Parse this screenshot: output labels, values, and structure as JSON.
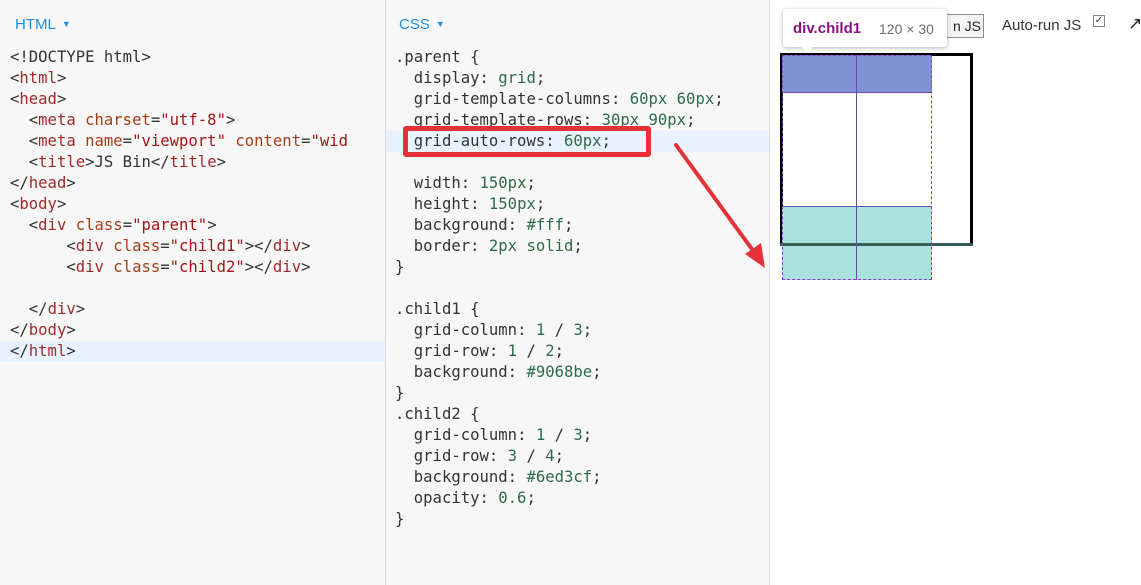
{
  "html_panel": {
    "label": "HTML",
    "lines": [
      "<!DOCTYPE html>",
      "<html>",
      "<head>",
      "  <meta charset=\"utf-8\">",
      "  <meta name=\"viewport\" content=\"wid",
      "  <title>JS Bin</title>",
      "</head>",
      "<body>",
      "  <div class=\"parent\">",
      "      <div class=\"child1\"></div>",
      "      <div class=\"child2\"></div>",
      "",
      "  </div>",
      "</body>",
      "</html>"
    ],
    "highlighted_line": 14
  },
  "css_panel": {
    "label": "CSS",
    "lines": [
      ".parent {",
      "  display: grid;",
      "  grid-template-columns: 60px 60px;",
      "  grid-template-rows: 30px 90px;",
      "  grid-auto-rows: 60px;",
      "",
      "  width: 150px;",
      "  height: 150px;",
      "  background: #fff;",
      "  border: 2px solid;",
      "}",
      "",
      ".child1 {",
      "  grid-column: 1 / 3;",
      "  grid-row: 1 / 2;",
      "  background: #9068be;",
      "}",
      ".child2 {",
      "  grid-column: 1 / 3;",
      "  grid-row: 3 / 4;",
      "  background: #6ed3cf;",
      "  opacity: 0.6;",
      "}"
    ],
    "highlighted_line": 4
  },
  "output_panel": {
    "run_button_label": "n JS",
    "autorun_label": "Auto-run JS",
    "autorun_checked": true,
    "tooltip": {
      "element_name": "div.child1",
      "element_size": "120 × 30"
    }
  },
  "colors": {
    "accent": "#1d8fdd",
    "annotation_red": "#e53238",
    "child1_fill": "#7f92d3",
    "child2_fill": "#a9e1de"
  },
  "icons": {
    "panel_menu": "caret-down-icon",
    "popout": "arrow-up-right-icon"
  }
}
